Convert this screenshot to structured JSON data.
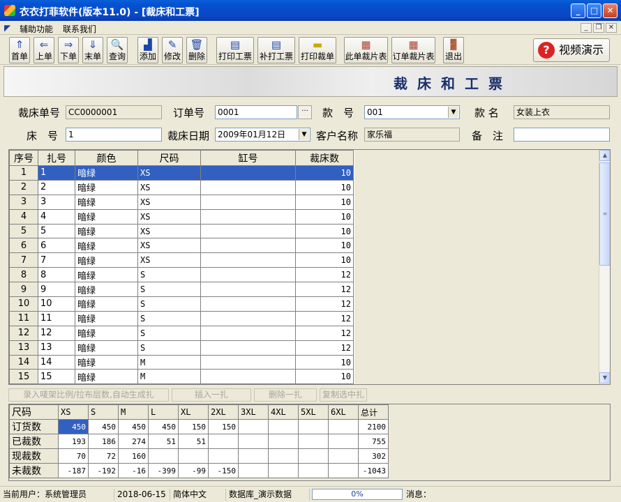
{
  "window": {
    "title": "衣衣打菲软件(版本11.0) - [裁床和工票]"
  },
  "menu": {
    "items": [
      "辅助功能",
      "联系我们"
    ]
  },
  "toolbar": {
    "buttons": [
      {
        "label": "首单"
      },
      {
        "label": "上单"
      },
      {
        "label": "下单"
      },
      {
        "label": "末单"
      },
      {
        "label": "查询"
      },
      {
        "label": "添加"
      },
      {
        "label": "修改"
      },
      {
        "label": "删除"
      },
      {
        "label": "打印工票"
      },
      {
        "label": "补打工票"
      },
      {
        "label": "打印裁单"
      },
      {
        "label": "此单裁片表"
      },
      {
        "label": "订单裁片表"
      },
      {
        "label": "退出"
      }
    ],
    "video_label": "视频演示"
  },
  "banner": {
    "title": "裁床和工票"
  },
  "form": {
    "cut_no_label": "裁床单号",
    "cut_no": "CC0000001",
    "order_no_label": "订单号",
    "order_no": "0001",
    "style_label": "款　号",
    "style_no": "001",
    "style_name_label": "款 名",
    "style_name": "女装上衣",
    "bed_no_label": "床　号",
    "bed_no": "1",
    "cut_date_label": "裁床日期",
    "cut_date": "2009年01月12日",
    "customer_label": "客户名称",
    "customer": "家乐福",
    "remark_label": "备　注",
    "remark": ""
  },
  "grid": {
    "headers": [
      "序号",
      "扎号",
      "颜色",
      "尺码",
      "缸号",
      "裁床数"
    ],
    "rows": [
      {
        "seq": "1",
        "bundle": "1",
        "color": "暗绿",
        "size": "XS",
        "dye_lot": "",
        "qty": "10"
      },
      {
        "seq": "2",
        "bundle": "2",
        "color": "暗绿",
        "size": "XS",
        "dye_lot": "",
        "qty": "10"
      },
      {
        "seq": "3",
        "bundle": "3",
        "color": "暗绿",
        "size": "XS",
        "dye_lot": "",
        "qty": "10"
      },
      {
        "seq": "4",
        "bundle": "4",
        "color": "暗绿",
        "size": "XS",
        "dye_lot": "",
        "qty": "10"
      },
      {
        "seq": "5",
        "bundle": "5",
        "color": "暗绿",
        "size": "XS",
        "dye_lot": "",
        "qty": "10"
      },
      {
        "seq": "6",
        "bundle": "6",
        "color": "暗绿",
        "size": "XS",
        "dye_lot": "",
        "qty": "10"
      },
      {
        "seq": "7",
        "bundle": "7",
        "color": "暗绿",
        "size": "XS",
        "dye_lot": "",
        "qty": "10"
      },
      {
        "seq": "8",
        "bundle": "8",
        "color": "暗绿",
        "size": "S",
        "dye_lot": "",
        "qty": "12"
      },
      {
        "seq": "9",
        "bundle": "9",
        "color": "暗绿",
        "size": "S",
        "dye_lot": "",
        "qty": "12"
      },
      {
        "seq": "10",
        "bundle": "10",
        "color": "暗绿",
        "size": "S",
        "dye_lot": "",
        "qty": "12"
      },
      {
        "seq": "11",
        "bundle": "11",
        "color": "暗绿",
        "size": "S",
        "dye_lot": "",
        "qty": "12"
      },
      {
        "seq": "12",
        "bundle": "12",
        "color": "暗绿",
        "size": "S",
        "dye_lot": "",
        "qty": "12"
      },
      {
        "seq": "13",
        "bundle": "13",
        "color": "暗绿",
        "size": "S",
        "dye_lot": "",
        "qty": "12"
      },
      {
        "seq": "14",
        "bundle": "14",
        "color": "暗绿",
        "size": "M",
        "dye_lot": "",
        "qty": "10"
      },
      {
        "seq": "15",
        "bundle": "15",
        "color": "暗绿",
        "size": "M",
        "dye_lot": "",
        "qty": "10"
      }
    ]
  },
  "actions": [
    "录入唛架比例/拉布层数,自动生成扎",
    "插入一扎",
    "删除一扎",
    "复制选中扎"
  ],
  "size_table": {
    "corner": "尺码",
    "sizes": [
      "XS",
      "S",
      "M",
      "L",
      "XL",
      "2XL",
      "3XL",
      "4XL",
      "5XL",
      "6XL",
      "总计"
    ],
    "rows": [
      {
        "label": "订货数",
        "values": [
          "450",
          "450",
          "450",
          "450",
          "150",
          "150",
          "",
          "",
          "",
          "",
          "2100"
        ]
      },
      {
        "label": "已裁数",
        "values": [
          "193",
          "186",
          "274",
          "51",
          "51",
          "",
          "",
          "",
          "",
          "",
          "755"
        ]
      },
      {
        "label": "现裁数",
        "values": [
          "70",
          "72",
          "160",
          "",
          "",
          "",
          "",
          "",
          "",
          "",
          "302"
        ]
      },
      {
        "label": "未裁数",
        "values": [
          "-187",
          "-192",
          "-16",
          "-399",
          "-99",
          "-150",
          "",
          "",
          "",
          "",
          "-1043"
        ]
      }
    ]
  },
  "status": {
    "user_label": "当前用户：",
    "user": "系统管理员",
    "date": "2018-06-15",
    "language": "简体中文",
    "database": "数据库_演示数据",
    "progress": "0%",
    "message_label": "消息："
  }
}
